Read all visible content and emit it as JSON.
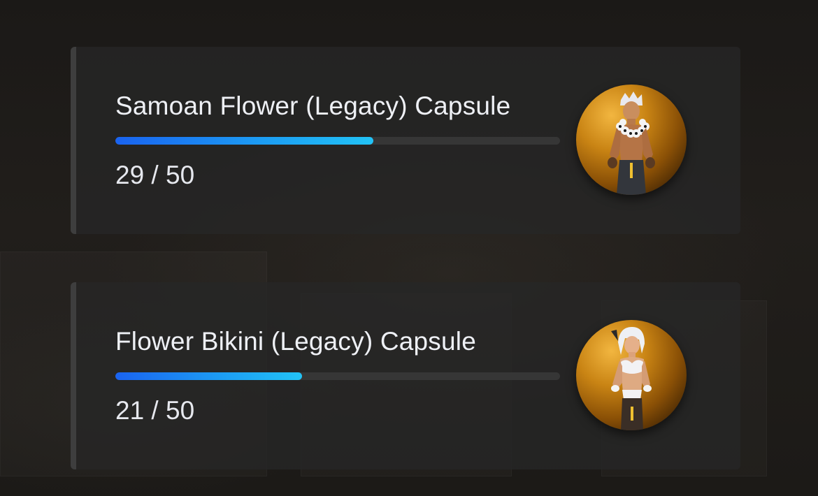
{
  "capsules": [
    {
      "title": "Samoan Flower (Legacy) Capsule",
      "count_text": "29 / 50",
      "current": 29,
      "total": 50,
      "icon": "character-portrait-icon"
    },
    {
      "title": "Flower Bikini (Legacy) Capsule",
      "count_text": "21 / 50",
      "current": 21,
      "total": 50,
      "icon": "character-portrait-icon"
    }
  ],
  "colors": {
    "progress_start": "#1a63f0",
    "progress_end": "#22c3f6",
    "track": "#363636",
    "card": "#262626",
    "portrait_gold": "#c98414"
  }
}
